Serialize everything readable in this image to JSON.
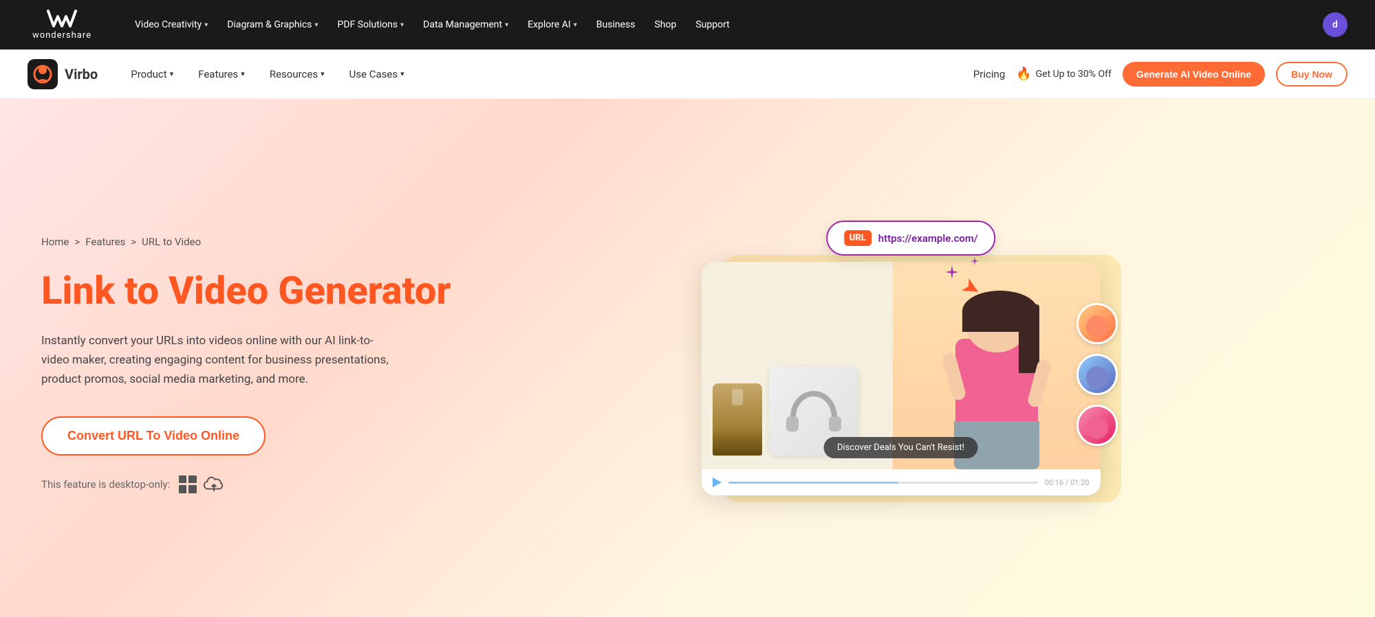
{
  "top_nav": {
    "logo_text": "wondershare",
    "logo_w": "❮❮",
    "items": [
      {
        "label": "Video Creativity",
        "has_dropdown": true
      },
      {
        "label": "Diagram & Graphics",
        "has_dropdown": true
      },
      {
        "label": "PDF Solutions",
        "has_dropdown": true
      },
      {
        "label": "Data Management",
        "has_dropdown": true
      },
      {
        "label": "Explore AI",
        "has_dropdown": true
      },
      {
        "label": "Business"
      },
      {
        "label": "Shop"
      },
      {
        "label": "Support"
      }
    ],
    "user_initial": "d"
  },
  "sub_nav": {
    "brand_name": "Virbo",
    "items": [
      {
        "label": "Product",
        "has_dropdown": true
      },
      {
        "label": "Features",
        "has_dropdown": true
      },
      {
        "label": "Resources",
        "has_dropdown": true
      },
      {
        "label": "Use Cases",
        "has_dropdown": true
      }
    ],
    "pricing_label": "Pricing",
    "offer_icon": "🔥",
    "offer_text": "Get Up to 30% Off",
    "btn_generate": "Generate AI Video Online",
    "btn_buy": "Buy Now"
  },
  "hero": {
    "breadcrumb_home": "Home",
    "breadcrumb_sep1": ">",
    "breadcrumb_features": "Features",
    "breadcrumb_sep2": ">",
    "breadcrumb_current": "URL to Video",
    "title": "Link to Video Generator",
    "description": "Instantly convert your URLs into videos online with our AI link-to-video maker, creating engaging content for business presentations, product promos, social media marketing, and more.",
    "btn_convert": "Convert URL To Video Online",
    "desktop_only_text": "This feature is desktop-only:",
    "url_tag": "URL",
    "url_example": "https://example.com/",
    "subtitle_text": "Discover Deals You Can't Resist!",
    "time_current": "00:16",
    "time_total": "01:20"
  }
}
